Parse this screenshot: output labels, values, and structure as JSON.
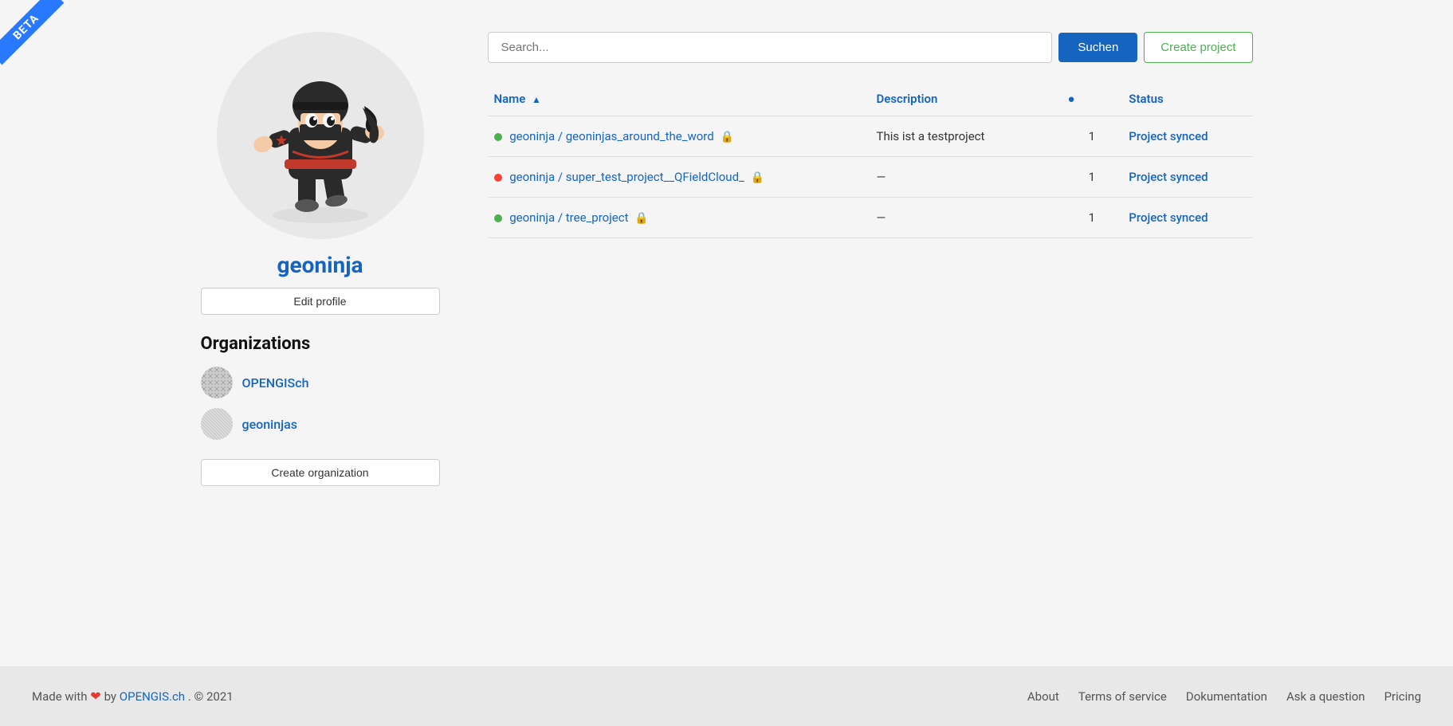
{
  "beta": {
    "label": "BETA"
  },
  "sidebar": {
    "username": "geoninja",
    "edit_profile_label": "Edit profile",
    "organizations_title": "Organizations",
    "organizations": [
      {
        "name": "OPENGISch",
        "id": "org-opengisch"
      },
      {
        "name": "geoninjas",
        "id": "org-geoninjas"
      }
    ],
    "create_org_label": "Create organization"
  },
  "search": {
    "placeholder": "Search...",
    "button_label": "Suchen"
  },
  "create_project": {
    "label": "Create project"
  },
  "table": {
    "headers": {
      "name": "Name",
      "description": "Description",
      "members": "👤",
      "status": "Status"
    },
    "rows": [
      {
        "owner": "geoninja",
        "repo": "geoninjas_around_the_word",
        "locked": true,
        "status_color": "green",
        "description": "This ist a testproject",
        "members": "1",
        "status": "Project synced"
      },
      {
        "owner": "geoninja",
        "repo": "super_test_project__QFieldCloud_",
        "locked": true,
        "status_color": "red",
        "description": "—",
        "members": "1",
        "status": "Project synced"
      },
      {
        "owner": "geoninja",
        "repo": "tree_project",
        "locked": true,
        "status_color": "green",
        "description": "—",
        "members": "1",
        "status": "Project synced"
      }
    ]
  },
  "footer": {
    "made_with": "Made with",
    "by_text": "by",
    "company_link": "OPENGIS.ch",
    "copyright": ". © 2021",
    "links": [
      {
        "label": "About",
        "href": "#"
      },
      {
        "label": "Terms of service",
        "href": "#"
      },
      {
        "label": "Dokumentation",
        "href": "#"
      },
      {
        "label": "Ask a question",
        "href": "#"
      },
      {
        "label": "Pricing",
        "href": "#"
      }
    ]
  }
}
